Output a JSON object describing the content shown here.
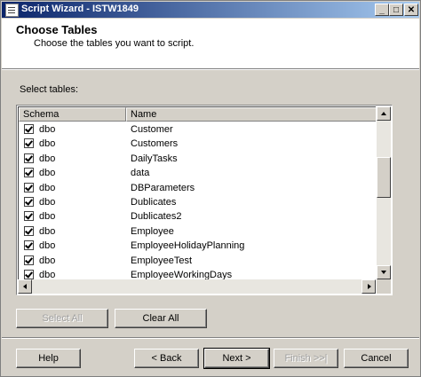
{
  "window": {
    "title": "Script Wizard - ISTW1849"
  },
  "title_buttons": {
    "minimize": "_",
    "maximize": "□",
    "close": "✕"
  },
  "header": {
    "title": "Choose Tables",
    "subtitle": "Choose the tables you want to script."
  },
  "select_label": "Select tables:",
  "table": {
    "columns": [
      "Schema",
      "Name"
    ],
    "rows": [
      {
        "checked": true,
        "schema": "dbo",
        "name": "Customer"
      },
      {
        "checked": true,
        "schema": "dbo",
        "name": "Customers"
      },
      {
        "checked": true,
        "schema": "dbo",
        "name": "DailyTasks"
      },
      {
        "checked": true,
        "schema": "dbo",
        "name": "data"
      },
      {
        "checked": true,
        "schema": "dbo",
        "name": "DBParameters"
      },
      {
        "checked": true,
        "schema": "dbo",
        "name": "Dublicates"
      },
      {
        "checked": true,
        "schema": "dbo",
        "name": "Dublicates2"
      },
      {
        "checked": true,
        "schema": "dbo",
        "name": "Employee"
      },
      {
        "checked": true,
        "schema": "dbo",
        "name": "EmployeeHolidayPlanning"
      },
      {
        "checked": true,
        "schema": "dbo",
        "name": "EmployeeTest"
      },
      {
        "checked": true,
        "schema": "dbo",
        "name": "EmployeeWorkingDays"
      }
    ],
    "vertical_scroll_position": 0.35
  },
  "buttons": {
    "select_all": "Select All",
    "clear_all": "Clear All",
    "help": "Help",
    "back": "< Back",
    "next": "Next >",
    "finish": "Finish >>|",
    "cancel": "Cancel"
  },
  "colors": {
    "title_start": "#0a246a",
    "title_end": "#a6caf0",
    "face": "#d4d0c8"
  }
}
